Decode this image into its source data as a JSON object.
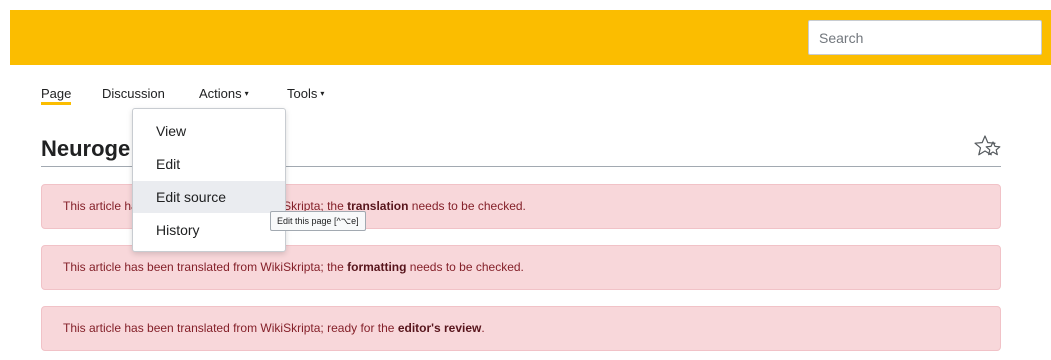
{
  "search": {
    "placeholder": "Search"
  },
  "tabs": [
    {
      "label": "Page",
      "active": true
    },
    {
      "label": "Discussion"
    },
    {
      "label": "Actions",
      "caret": "▾"
    },
    {
      "label": "Tools",
      "caret": "▾"
    }
  ],
  "page": {
    "title": "Neuroge"
  },
  "notices": [
    {
      "before": "This article has been translated from WikiSkripta; the ",
      "bold": "translation",
      "after": " needs to be checked."
    },
    {
      "before": "This article has been translated from WikiSkripta; the ",
      "bold": "formatting",
      "after": " needs to be checked."
    },
    {
      "before": "This article has been translated from WikiSkripta; ready for the ",
      "bold": "editor's review",
      "after": "."
    }
  ],
  "actions_menu": {
    "items": [
      {
        "label": "View"
      },
      {
        "label": "Edit"
      },
      {
        "label": "Edit source",
        "hovered": true
      },
      {
        "label": "History"
      }
    ]
  },
  "tooltip": {
    "text": "Edit this page [^⌥e]"
  },
  "icons": {
    "watch": "star-outline-icon"
  },
  "colors": {
    "header": "#fbbd00",
    "notice_bg": "#f8d7da",
    "notice_text": "#842029",
    "menu_hover": "#eaecf0"
  }
}
